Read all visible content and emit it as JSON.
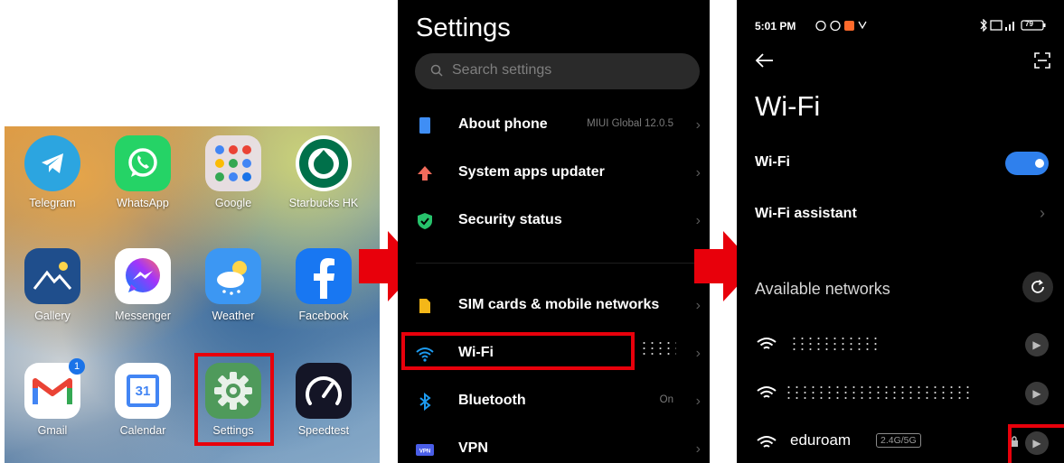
{
  "home": {
    "apps": [
      {
        "label": "Telegram",
        "icon": "telegram-icon",
        "color": "#2ca5e0"
      },
      {
        "label": "WhatsApp",
        "icon": "whatsapp-icon",
        "color": "#25d366"
      },
      {
        "label": "Google",
        "icon": "google-folder-icon",
        "color": "#e9e2ea"
      },
      {
        "label": "Starbucks HK",
        "icon": "starbucks-icon",
        "color": "#00704a"
      },
      {
        "label": "Gallery",
        "icon": "gallery-icon",
        "color": "#1f4e8c"
      },
      {
        "label": "Messenger",
        "icon": "messenger-icon",
        "color": "#ffffff"
      },
      {
        "label": "Weather",
        "icon": "weather-icon",
        "color": "#3c97f3"
      },
      {
        "label": "Facebook",
        "icon": "facebook-icon",
        "color": "#1877f2"
      },
      {
        "label": "Gmail",
        "icon": "gmail-icon",
        "color": "#ffffff",
        "badge": "1"
      },
      {
        "label": "Calendar",
        "icon": "calendar-icon",
        "color": "#ffffff",
        "date": "31"
      },
      {
        "label": "Settings",
        "icon": "settings-gear-icon",
        "color": "#4f9a5b"
      },
      {
        "label": "Speedtest",
        "icon": "speedtest-icon",
        "color": "#141526"
      }
    ]
  },
  "settings": {
    "title": "Settings",
    "search_placeholder": "Search settings",
    "items": [
      {
        "label": "About phone",
        "value": "MIUI Global 12.0.5",
        "icon": "phone-icon",
        "color": "#3f8ef5"
      },
      {
        "label": "System apps updater",
        "value": "",
        "icon": "update-arrow-icon",
        "color": "#f26b5b"
      },
      {
        "label": "Security status",
        "value": "",
        "icon": "shield-check-icon",
        "color": "#27c26c"
      },
      {
        "label": "SIM cards & mobile networks",
        "value": "",
        "icon": "sim-card-icon",
        "color": "#f4b718"
      },
      {
        "label": "Wi-Fi",
        "value": "",
        "icon": "wifi-icon",
        "color": "#1d9bf0"
      },
      {
        "label": "Bluetooth",
        "value": "On",
        "icon": "bluetooth-icon",
        "color": "#1d9bf0"
      },
      {
        "label": "VPN",
        "value": "",
        "icon": "vpn-icon",
        "color": "#4a5ee8"
      }
    ]
  },
  "wifi": {
    "status_time": "5:01 PM",
    "battery": "79",
    "title": "Wi-Fi",
    "toggle_label": "Wi-Fi",
    "toggle_on": true,
    "assistant_label": "Wi-Fi assistant",
    "available_label": "Available networks",
    "networks": [
      {
        "ssid": "",
        "band": ""
      },
      {
        "ssid": "",
        "band": ""
      },
      {
        "ssid": "eduroam",
        "band": "2.4G/5G",
        "locked": true
      }
    ]
  },
  "accent": "#e8000b"
}
